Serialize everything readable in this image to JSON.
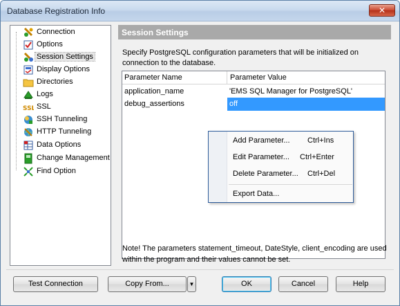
{
  "window": {
    "title": "Database Registration Info",
    "close_label": "✕"
  },
  "tree": {
    "items": [
      {
        "label": "Connection",
        "icon": "connection-icon"
      },
      {
        "label": "Options",
        "icon": "options-icon"
      },
      {
        "label": "Session Settings",
        "icon": "session-settings-icon",
        "selected": true
      },
      {
        "label": "Display Options",
        "icon": "display-options-icon"
      },
      {
        "label": "Directories",
        "icon": "folder-icon"
      },
      {
        "label": "Logs",
        "icon": "logs-icon"
      },
      {
        "label": "SSL",
        "icon": "ssl-icon"
      },
      {
        "label": "SSH Tunneling",
        "icon": "ssh-tunneling-icon"
      },
      {
        "label": "HTTP Tunneling",
        "icon": "http-tunneling-icon"
      },
      {
        "label": "Data Options",
        "icon": "data-options-icon"
      },
      {
        "label": "Change Management",
        "icon": "change-management-icon"
      },
      {
        "label": "Find Option",
        "icon": "find-option-icon"
      }
    ]
  },
  "panel": {
    "header": "Session Settings",
    "description": "Specify PostgreSQL configuration parameters that will be initialized on connection to the database.",
    "grid": {
      "columns": [
        "Parameter Name",
        "Parameter Value"
      ],
      "rows": [
        {
          "name": "application_name",
          "value": "'EMS SQL Manager for PostgreSQL'"
        },
        {
          "name": "debug_assertions",
          "value": "off"
        }
      ]
    },
    "note": "Note! The parameters statement_timeout, DateStyle, client_encoding are used within the program and their values cannot be set."
  },
  "context_menu": {
    "items": [
      {
        "label": "Add Parameter...",
        "shortcut": "Ctrl+Ins"
      },
      {
        "label": "Edit Parameter...",
        "shortcut": "Ctrl+Enter"
      },
      {
        "label": "Delete Parameter...",
        "shortcut": "Ctrl+Del"
      },
      {
        "label": "Export Data...",
        "shortcut": ""
      }
    ]
  },
  "buttons": {
    "test_connection": "Test Connection",
    "copy_from": "Copy From...",
    "copy_from_arrow": "▼",
    "ok": "OK",
    "cancel": "Cancel",
    "help": "Help"
  }
}
